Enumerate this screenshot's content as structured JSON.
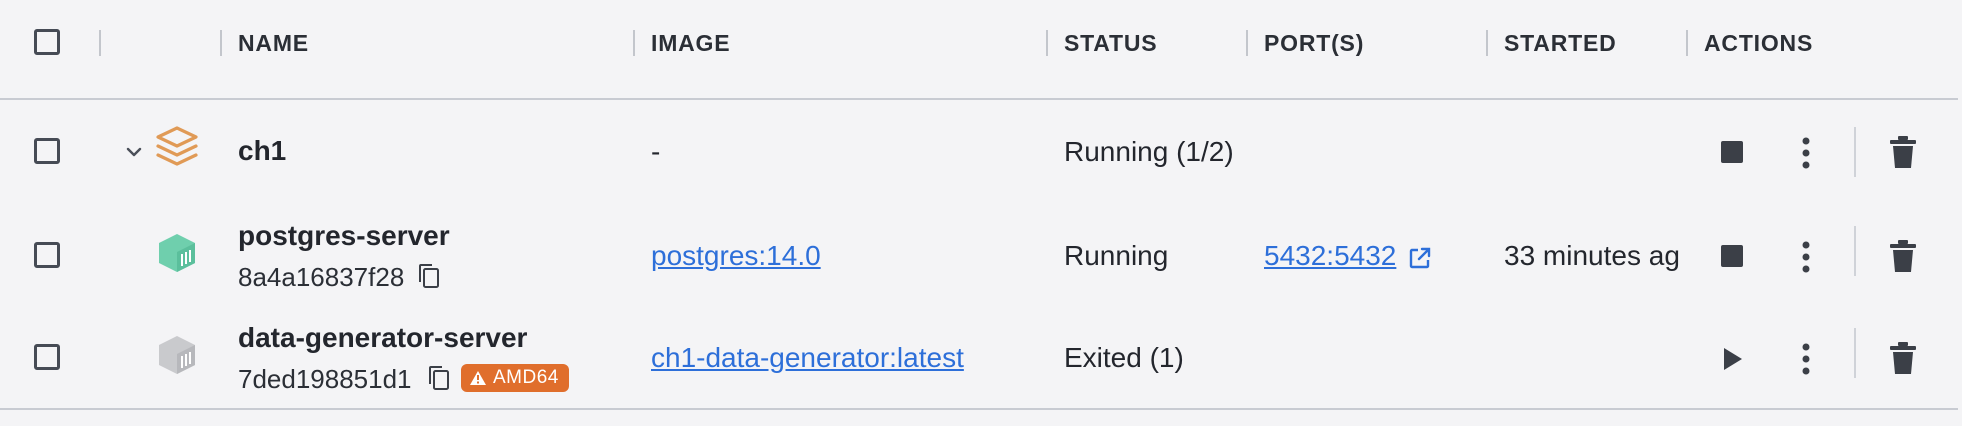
{
  "header": {
    "name": "NAME",
    "image": "IMAGE",
    "status": "STATUS",
    "ports": "PORT(S)",
    "started": "STARTED",
    "actions": "ACTIONS"
  },
  "rows": [
    {
      "name": "ch1",
      "image": "-",
      "status": "Running (1/2)",
      "icon": "stack-icon",
      "action_primary": "stop"
    },
    {
      "name": "postgres-server",
      "id": "8a4a16837f28",
      "image": "postgres:14.0",
      "status": "Running",
      "ports": "5432:5432",
      "started": "33 minutes ag",
      "icon": "container-icon",
      "icon_color": "#6fcfad",
      "action_primary": "stop"
    },
    {
      "name": "data-generator-server",
      "id": "7ded198851d1",
      "badge": "AMD64",
      "image": "ch1-data-generator:latest",
      "status": "Exited (1)",
      "icon": "container-icon",
      "icon_color": "#c9cacd",
      "action_primary": "start"
    }
  ],
  "colors": {
    "link": "#2d6fd9",
    "badge": "#e06e2c",
    "stack": "#e09a56"
  }
}
